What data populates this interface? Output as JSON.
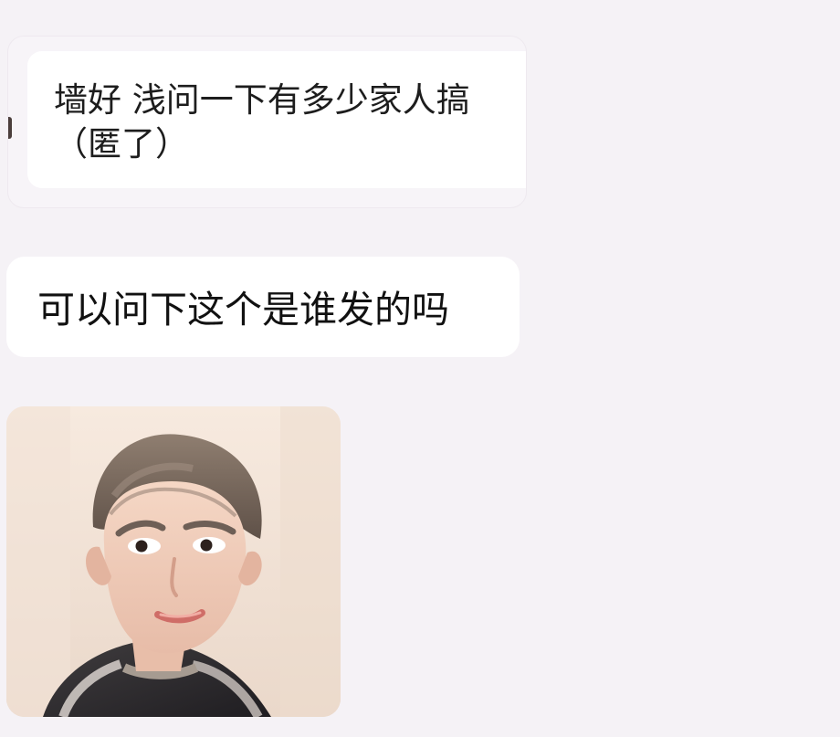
{
  "chat": {
    "quoted_message": {
      "line1": "墙好 浅问一下有多少家人搞",
      "line2": "（匿了）"
    },
    "message": {
      "text": "可以问下这个是谁发的吗"
    },
    "image_message": {
      "icon": "person-photo"
    }
  },
  "colors": {
    "background": "#f5f2f6",
    "bubble": "#ffffff",
    "text": "#111111"
  }
}
